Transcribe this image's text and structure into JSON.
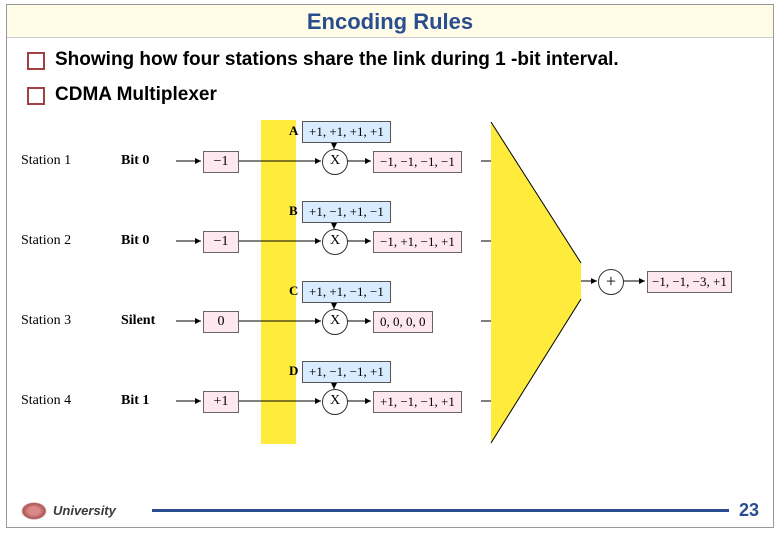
{
  "title": "Encoding Rules",
  "bullets": {
    "b1": "Showing how four stations share the link during 1 -bit interval.",
    "b2": "CDMA Multiplexer"
  },
  "stations": [
    {
      "name": "Station 1",
      "bit": "Bit 0",
      "val": "−1",
      "codeLetter": "A",
      "code": "+1, +1, +1, +1",
      "result": "−1, −1, −1, −1"
    },
    {
      "name": "Station 2",
      "bit": "Bit 0",
      "val": "−1",
      "codeLetter": "B",
      "code": "+1, −1, +1, −1",
      "result": "−1, +1, −1, +1"
    },
    {
      "name": "Station 3",
      "bit": "Silent",
      "val": "0",
      "codeLetter": "C",
      "code": "+1, +1, −1, −1",
      "result": "0, 0, 0, 0"
    },
    {
      "name": "Station 4",
      "bit": "Bit 1",
      "val": "+1",
      "codeLetter": "D",
      "code": "+1, −1, −1, +1",
      "result": "+1, −1, −1, +1"
    }
  ],
  "op_mul": "X",
  "op_add": "+",
  "final_result": "−1, −1, −3, +1",
  "footer": {
    "university": "University",
    "page": "23"
  }
}
